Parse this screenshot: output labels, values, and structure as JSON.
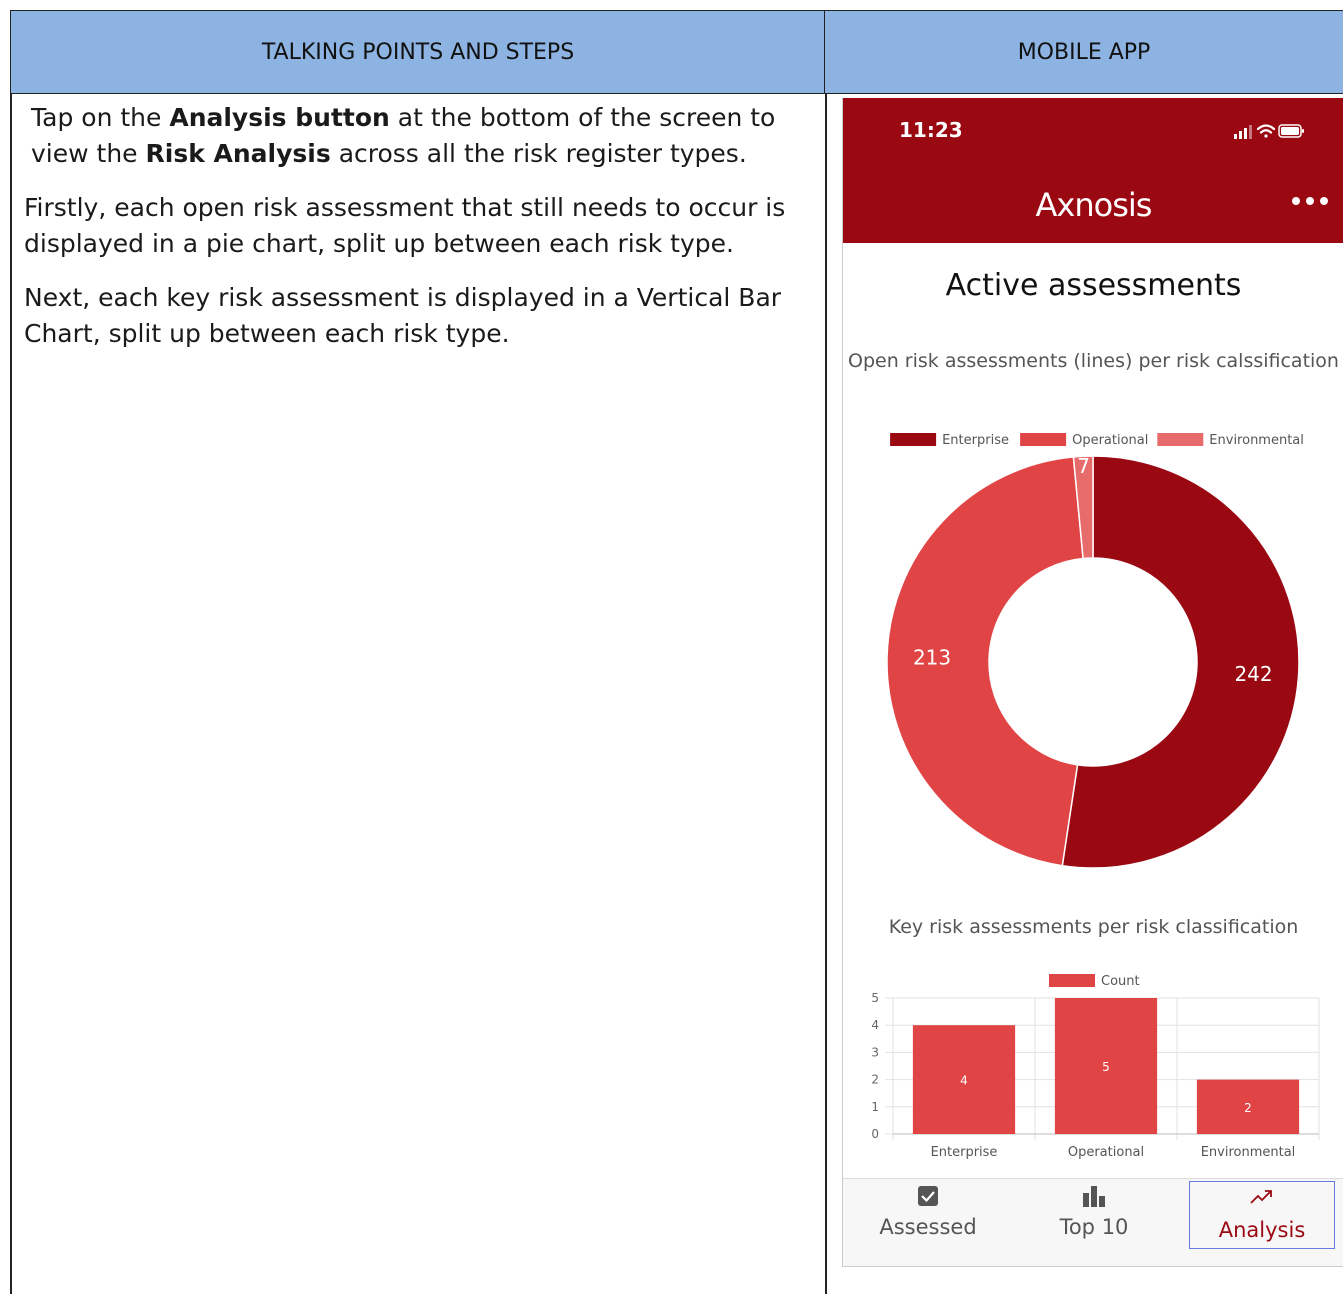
{
  "table": {
    "left_header": "TALKING POINTS AND STEPS",
    "right_header": "MOBILE APP"
  },
  "steps": {
    "p1_a": "Tap on the ",
    "p1_b": "Analysis button",
    "p1_c": " at the bottom of the screen to view the ",
    "p1_d": "Risk Analysis",
    "p1_e": " across all the risk register types.",
    "p2": "Firstly, each open risk assessment that still needs to occur is displayed in a pie chart, split up between each risk type.",
    "p3": "Next, each key risk assessment is displayed in a Vertical Bar Chart, split up between each risk type."
  },
  "phone": {
    "time": "11:23",
    "logo": "Axnosis",
    "screen_title": "Active assessments",
    "tabs": [
      {
        "label": "Assessed",
        "icon": "checkbox-icon",
        "active": false
      },
      {
        "label": "Top 10",
        "icon": "bar-chart-icon",
        "active": false
      },
      {
        "label": "Analysis",
        "icon": "trend-up-icon",
        "active": true
      }
    ],
    "colors": {
      "brand": "#9a0812",
      "operational": "#e04444",
      "environmental": "#e86b6b"
    }
  },
  "chart_data": [
    {
      "type": "pie",
      "title": "Open risk assessments (lines) per risk calssification",
      "categories": [
        "Enterprise",
        "Operational",
        "Environmental"
      ],
      "values": [
        242,
        213,
        7
      ],
      "colors": [
        "#9a0812",
        "#e04444",
        "#e86b6b"
      ],
      "legend": "top"
    },
    {
      "type": "bar",
      "title": "Key risk assessments per risk classification",
      "categories": [
        "Enterprise",
        "Operational",
        "Environmental"
      ],
      "series": [
        {
          "name": "Count",
          "values": [
            4,
            5,
            2
          ]
        }
      ],
      "ylim": [
        0,
        5
      ],
      "yticks": [
        "0",
        "1",
        "2",
        "3",
        "4",
        "5"
      ],
      "grid": true,
      "legend": "top"
    }
  ]
}
